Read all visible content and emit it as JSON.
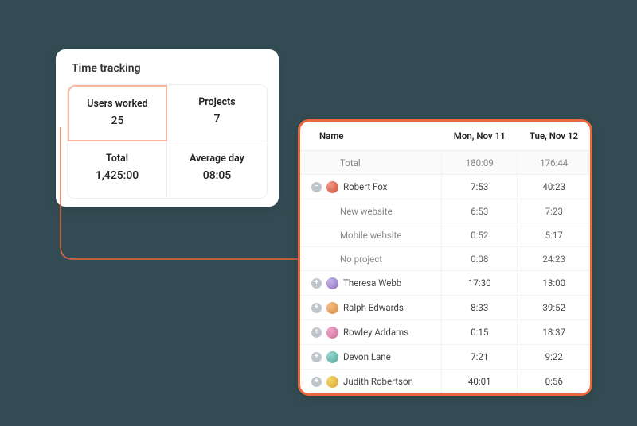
{
  "summary": {
    "title": "Time tracking",
    "cells": [
      {
        "label": "Users worked",
        "value": "25",
        "highlight": true
      },
      {
        "label": "Projects",
        "value": "7",
        "highlight": false
      },
      {
        "label": "Total",
        "value": "1,425:00",
        "highlight": false
      },
      {
        "label": "Average day",
        "value": "08:05",
        "highlight": false
      }
    ]
  },
  "colors": {
    "accent": "#e8683b",
    "highlight_border": "#f5b7a3"
  },
  "detail": {
    "columns": [
      "Name",
      "Mon, Nov 11",
      "Tue, Nov 12"
    ],
    "total_row": {
      "label": "Total",
      "values": [
        "180:09",
        "176:44"
      ]
    },
    "rows": [
      {
        "type": "user",
        "expanded": true,
        "avatar": "av-red",
        "name": "Robert Fox",
        "values": [
          "7:53",
          "40:23"
        ],
        "children": [
          {
            "name": "New website",
            "values": [
              "6:53",
              "7:23"
            ]
          },
          {
            "name": "Mobile website",
            "values": [
              "0:52",
              "5:17"
            ]
          },
          {
            "name": "No project",
            "values": [
              "0:08",
              "24:23"
            ]
          }
        ]
      },
      {
        "type": "user",
        "expanded": false,
        "avatar": "av-purple",
        "name": "Theresa Webb",
        "values": [
          "17:30",
          "13:00"
        ]
      },
      {
        "type": "user",
        "expanded": false,
        "avatar": "av-orange",
        "name": "Ralph Edwards",
        "values": [
          "8:33",
          "39:52"
        ]
      },
      {
        "type": "user",
        "expanded": false,
        "avatar": "av-pink",
        "name": "Rowley Addams",
        "values": [
          "0:15",
          "18:37"
        ]
      },
      {
        "type": "user",
        "expanded": false,
        "avatar": "av-teal",
        "name": "Devon Lane",
        "values": [
          "7:21",
          "9:22"
        ]
      },
      {
        "type": "user",
        "expanded": false,
        "avatar": "av-yellow",
        "name": "Judith Robertson",
        "values": [
          "40:01",
          "0:56"
        ]
      }
    ]
  }
}
